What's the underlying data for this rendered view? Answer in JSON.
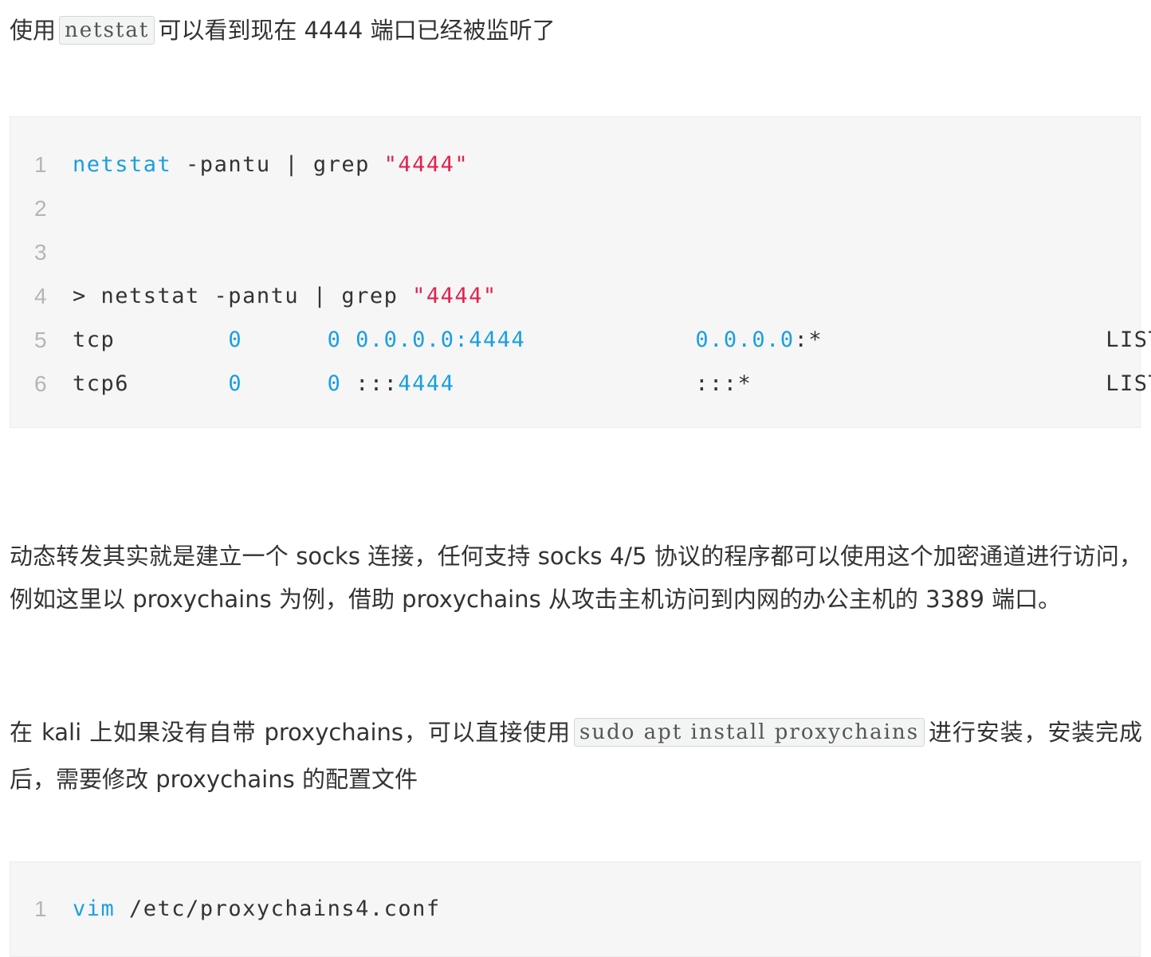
{
  "para1": {
    "before": "使用",
    "code": "netstat",
    "after": "可以看到现在 4444 端口已经被监听了"
  },
  "code_block_1": {
    "lines": [
      {
        "n": "1",
        "parts": [
          {
            "t": "netstat",
            "c": "kw"
          },
          {
            "t": " -pantu | grep ",
            "c": ""
          },
          {
            "t": "\"4444\"",
            "c": "str"
          }
        ]
      },
      {
        "n": "2",
        "parts": []
      },
      {
        "n": "3",
        "parts": []
      },
      {
        "n": "4",
        "parts": [
          {
            "t": "> netstat -pantu | grep ",
            "c": ""
          },
          {
            "t": "\"4444\"",
            "c": "str"
          }
        ]
      },
      {
        "n": "5",
        "parts": [
          {
            "t": "tcp        ",
            "c": ""
          },
          {
            "t": "0",
            "c": "num"
          },
          {
            "t": "      ",
            "c": ""
          },
          {
            "t": "0",
            "c": "num"
          },
          {
            "t": " ",
            "c": ""
          },
          {
            "t": "0.0.0.0:4444",
            "c": "num"
          },
          {
            "t": "            ",
            "c": ""
          },
          {
            "t": "0.0.0.0",
            "c": "num"
          },
          {
            "t": ":*                    LISTEN",
            "c": ""
          }
        ]
      },
      {
        "n": "6",
        "parts": [
          {
            "t": "tcp6       ",
            "c": ""
          },
          {
            "t": "0",
            "c": "num"
          },
          {
            "t": "      ",
            "c": ""
          },
          {
            "t": "0",
            "c": "num"
          },
          {
            "t": " :::",
            "c": ""
          },
          {
            "t": "4444",
            "c": "num"
          },
          {
            "t": "                 :::*                         LISTEN",
            "c": ""
          }
        ]
      }
    ]
  },
  "para2": {
    "text": "动态转发其实就是建立一个 socks 连接，任何支持 socks 4/5 协议的程序都可以使用这个加密通道进行访问，例如这里以 proxychains 为例，借助 proxychains 从攻击主机访问到内网的办公主机的 3389 端口。"
  },
  "para3": {
    "before": "在 kali 上如果没有自带 proxychains，可以直接使用",
    "code": "sudo apt install proxychains",
    "after": "进行安装，安装完成后，需要修改 proxychains 的配置文件"
  },
  "code_block_2": {
    "lines": [
      {
        "n": "1",
        "parts": [
          {
            "t": "vim",
            "c": "kw"
          },
          {
            "t": " /etc/proxychains4.conf",
            "c": ""
          }
        ]
      }
    ]
  }
}
